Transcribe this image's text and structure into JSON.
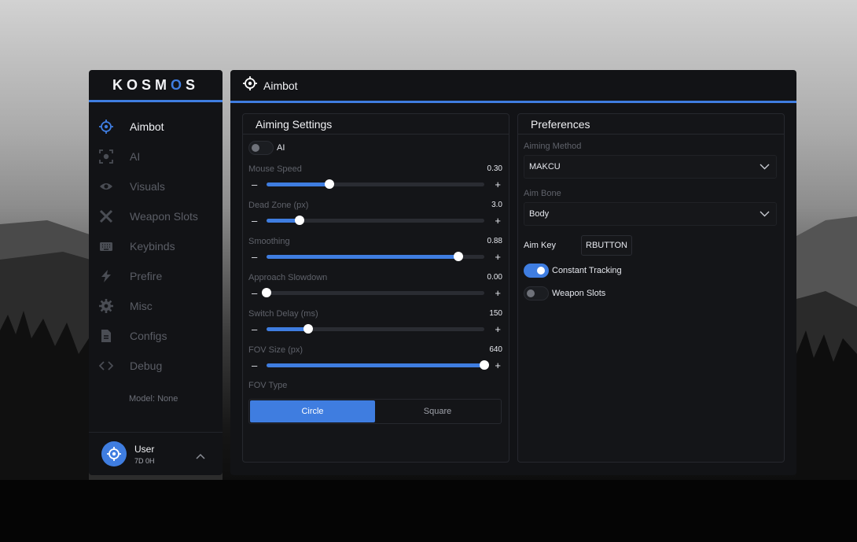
{
  "brand": {
    "logo_text_a": "K",
    "logo_text_b": "OSM",
    "logo_text_c": "O",
    "logo_text_d": "S"
  },
  "sidebar": {
    "items": [
      {
        "label": "Aimbot",
        "icon": "crosshair-icon",
        "active": true
      },
      {
        "label": "AI",
        "icon": "scan-eye-icon"
      },
      {
        "label": "Visuals",
        "icon": "eye-icon"
      },
      {
        "label": "Weapon Slots",
        "icon": "crossed-swords-icon"
      },
      {
        "label": "Keybinds",
        "icon": "keyboard-icon"
      },
      {
        "label": "Prefire",
        "icon": "lightning-icon"
      },
      {
        "label": "Misc",
        "icon": "gear-icon"
      },
      {
        "label": "Configs",
        "icon": "document-icon"
      },
      {
        "label": "Debug",
        "icon": "code-icon"
      }
    ],
    "model_status": "Model: None",
    "user": {
      "name": "User",
      "sub": "7D 0H"
    }
  },
  "header": {
    "title": "Aimbot"
  },
  "aiming": {
    "title": "Aiming Settings",
    "ai_toggle": {
      "label": "AI",
      "on": false
    },
    "sliders": [
      {
        "label": "Mouse Speed",
        "value": "0.30",
        "fraction": 0.29
      },
      {
        "label": "Dead Zone (px)",
        "value": "3.0",
        "fraction": 0.15
      },
      {
        "label": "Smoothing",
        "value": "0.88",
        "fraction": 0.88
      },
      {
        "label": "Approach Slowdown",
        "value": "0.00",
        "fraction": 0.0
      },
      {
        "label": "Switch Delay (ms)",
        "value": "150",
        "fraction": 0.19
      },
      {
        "label": "FOV Size (px)",
        "value": "640",
        "fraction": 1.0
      }
    ],
    "fov_type": {
      "label": "FOV Type",
      "options": [
        "Circle",
        "Square"
      ],
      "selected": "Circle"
    }
  },
  "preferences": {
    "title": "Preferences",
    "aiming_method": {
      "label": "Aiming Method",
      "value": "MAKCU"
    },
    "aim_bone": {
      "label": "Aim Bone",
      "value": "Body"
    },
    "aim_key": {
      "label": "Aim Key",
      "value": "RBUTTON"
    },
    "constant_tracking": {
      "label": "Constant Tracking",
      "on": true
    },
    "weapon_slots": {
      "label": "Weapon Slots",
      "on": false
    }
  },
  "colors": {
    "accent": "#3f7de0",
    "panel": "#121316",
    "muted_text": "#5f626a"
  }
}
